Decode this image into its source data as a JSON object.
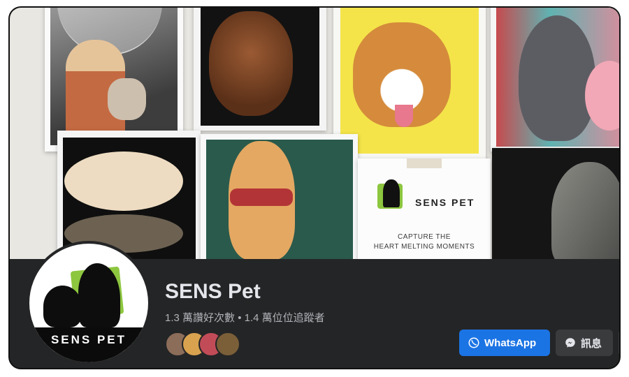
{
  "cover": {
    "brand_name": "SENS PET",
    "tagline_line1": "CAPTURE THE",
    "tagline_line2": "HEART MELTING MOMENTS"
  },
  "profile": {
    "avatar_label": "SENS PET",
    "page_name": "SENS Pet",
    "stats": "1.3 萬讚好次數 • 1.4 萬位位追蹤者"
  },
  "actions": {
    "whatsapp_label": "WhatsApp",
    "message_label": "訊息"
  },
  "colors": {
    "primary_button": "#1b74e4",
    "secondary_button": "#3a3b3c",
    "background": "#242526",
    "brand_green": "#8dc63f"
  },
  "icons": [
    "whatsapp-icon",
    "messenger-icon"
  ]
}
